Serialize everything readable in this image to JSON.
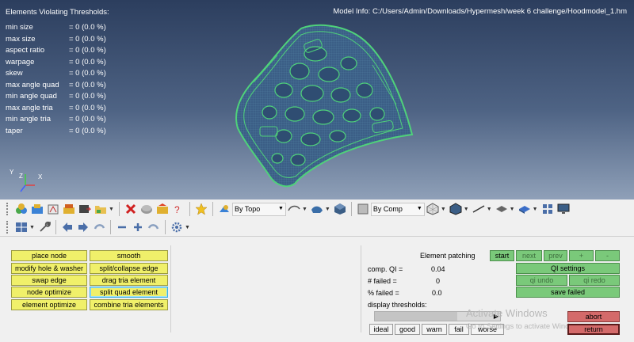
{
  "viewport": {
    "thresholds_title": "Elements Violating Thresholds:",
    "model_info": "Model Info: C:/Users/Admin/Downloads/Hypermesh/week 6 challenge/Hoodmodel_1.hm",
    "thresholds": [
      {
        "name": "min size",
        "value": "= 0 (0.0 %)"
      },
      {
        "name": "max size",
        "value": "= 0 (0.0 %)"
      },
      {
        "name": "aspect ratio",
        "value": "= 0 (0.0 %)"
      },
      {
        "name": "warpage",
        "value": "= 0 (0.0 %)"
      },
      {
        "name": "skew",
        "value": "= 0 (0.0 %)"
      },
      {
        "name": "max angle quad",
        "value": "= 0 (0.0 %)"
      },
      {
        "name": "min angle quad",
        "value": "= 0 (0.0 %)"
      },
      {
        "name": "max angle tria",
        "value": "= 0 (0.0 %)"
      },
      {
        "name": "min angle tria",
        "value": "= 0 (0.0 %)"
      },
      {
        "name": "taper",
        "value": "= 0 (0.0 %)"
      }
    ],
    "axis": {
      "x": "X",
      "y": "Y",
      "z": "Z"
    }
  },
  "toolbar": {
    "by_topo": "By Topo",
    "by_comp": "By Comp"
  },
  "panel": {
    "left_buttons": [
      {
        "label": "place node"
      },
      {
        "label": "modify hole & washer"
      },
      {
        "label": "swap edge"
      },
      {
        "label": "node optimize"
      },
      {
        "label": "element optimize"
      }
    ],
    "mid_buttons": [
      {
        "label": "smooth"
      },
      {
        "label": "split/collapse edge"
      },
      {
        "label": "drag tria element"
      },
      {
        "label": "split quad element"
      },
      {
        "label": "combine tria elements"
      }
    ],
    "element_patching": "Element patching",
    "comp_qi_label": "comp. QI =",
    "comp_qi_value": "0.04",
    "failed_count_label": "# failed =",
    "failed_count_value": "0",
    "failed_pct_label": "% failed =",
    "failed_pct_value": "0.0",
    "display_thresholds": "display thresholds:",
    "nav": {
      "start": "start",
      "next": "next",
      "prev": "prev",
      "plus": "+",
      "minus": "-"
    },
    "qi_settings": "QI settings",
    "qi_undo": "qi undo",
    "qi_redo": "qi redo",
    "save_failed": "save failed",
    "threshold_buttons": [
      "ideal",
      "good",
      "warn",
      "fail",
      "worse"
    ],
    "abort": "abort",
    "return": "return"
  },
  "watermark": {
    "line1": "Activate Windows",
    "line2": "Go to Settings to activate Windows."
  },
  "colors": {
    "yellow_button": "#f0f06a",
    "green_button": "#7ac97a",
    "red_button": "#d46a6a",
    "mesh_face": "#3b5e86",
    "mesh_edge": "#4fd27a"
  }
}
